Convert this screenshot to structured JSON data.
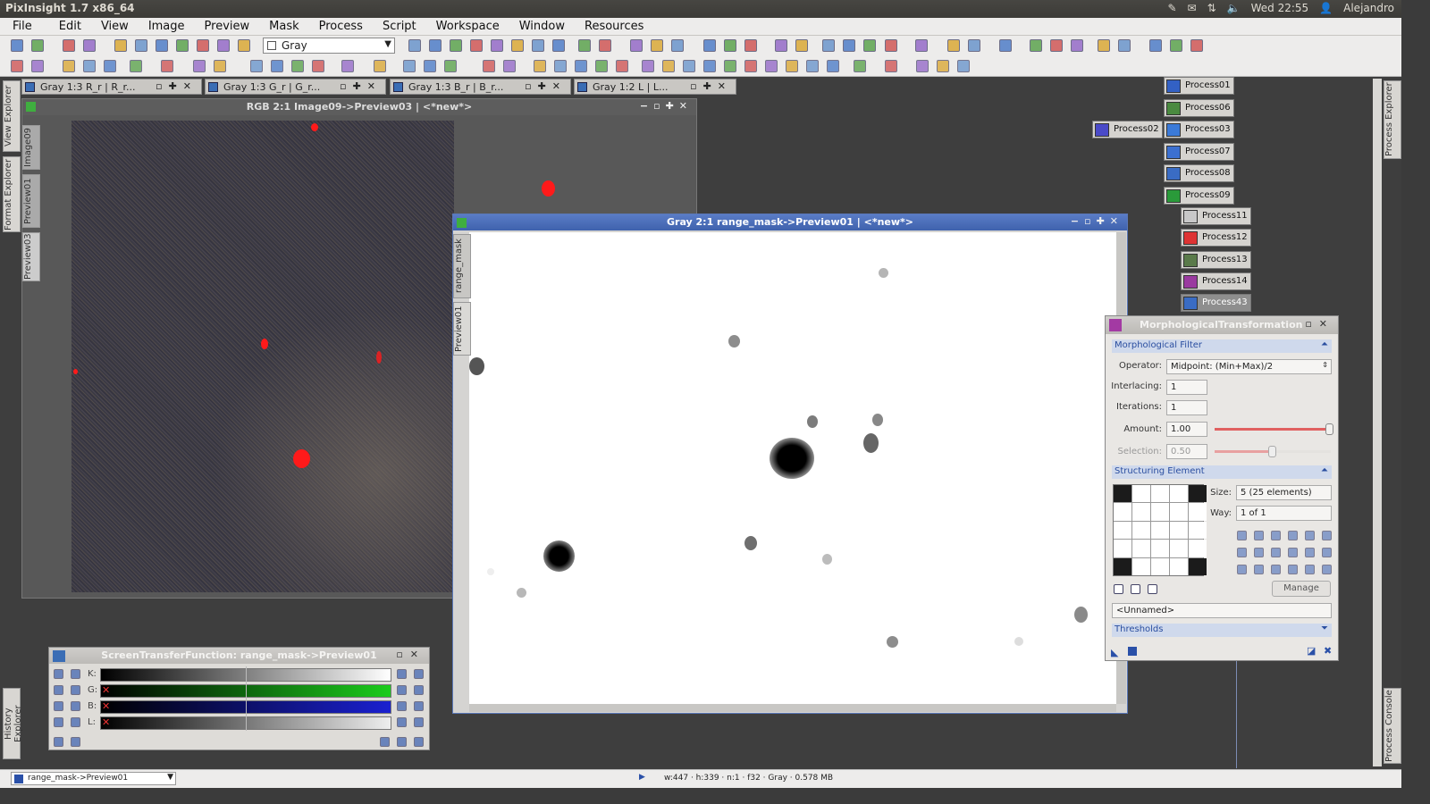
{
  "system": {
    "title": "PixInsight 1.7 x86_64",
    "clock": "Wed 22:55",
    "user": "Alejandro"
  },
  "menu": [
    "File",
    "Edit",
    "View",
    "Image",
    "Preview",
    "Mask",
    "Process",
    "Script",
    "Workspace",
    "Window",
    "Resources"
  ],
  "toolbar": {
    "colorspace_value": "Gray"
  },
  "side_tabs": {
    "left": [
      "View Explorer",
      "Format Explorer",
      "History Explorer"
    ],
    "right": [
      "Process Explorer",
      "Process Console"
    ],
    "rgb_window": [
      "Image09",
      "Preview01",
      "Preview03"
    ],
    "mask_window": [
      "range_mask",
      "Preview01"
    ]
  },
  "tabs": [
    "Gray 1:3 R_r | R_r...",
    "Gray 1:3 G_r | G_r...",
    "Gray 1:3 B_r | B_r...",
    "Gray 1:2 L | L..."
  ],
  "rgb_window": {
    "title": "RGB 2:1 Image09->Preview03 | <*new*>"
  },
  "mask_window": {
    "title": "Gray 2:1 range_mask->Preview01 | <*new*>"
  },
  "process_icons": [
    "Process01",
    "Process06",
    "Process02",
    "Process03",
    "Process07",
    "Process08",
    "Process09",
    "Process11",
    "Process12",
    "Process13",
    "Process14",
    "Process43"
  ],
  "morph": {
    "title": "MorphologicalTransformation",
    "section_filter": "Morphological Filter",
    "operator_label": "Operator:",
    "operator_value": "Midpoint: (Min+Max)/2",
    "interlacing_label": "Interlacing:",
    "interlacing_value": "1",
    "iterations_label": "Iterations:",
    "iterations_value": "1",
    "amount_label": "Amount:",
    "amount_value": "1.00",
    "selection_label": "Selection:",
    "selection_value": "0.50",
    "section_struct": "Structuring Element",
    "size_label": "Size:",
    "size_value": "5  (25 elements)",
    "way_label": "Way:",
    "way_value": "1 of 1",
    "manage_label": "Manage",
    "name_value": "<Unnamed>",
    "section_thresholds": "Thresholds",
    "amount_level": 1.0,
    "selection_level": 0.5,
    "element_grid": [
      1,
      0,
      0,
      0,
      1,
      0,
      0,
      0,
      0,
      0,
      0,
      0,
      0,
      0,
      0,
      0,
      0,
      0,
      0,
      0,
      1,
      0,
      0,
      0,
      1
    ]
  },
  "stf": {
    "title": "ScreenTransferFunction: range_mask->Preview01",
    "channels": [
      "K:",
      "G:",
      "B:",
      "L:"
    ]
  },
  "status": {
    "view": "range_mask->Preview01",
    "info": "w:447 · h:339 · n:1 · f32 · Gray · 0.578 MB"
  },
  "colors": {
    "accent": "#3f62ad",
    "section_text": "#2a4ea0",
    "stf_green": "#1ccc1c",
    "stf_blue": "#1a20d0"
  }
}
